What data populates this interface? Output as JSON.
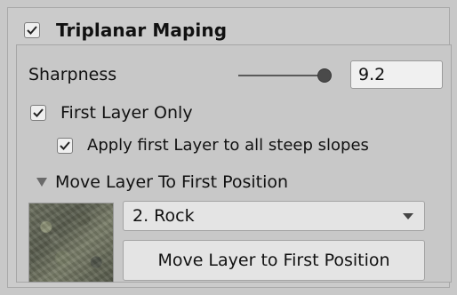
{
  "section": {
    "title": "Triplanar Maping",
    "enabled": true
  },
  "sharpness": {
    "label": "Sharpness",
    "value": "9.2",
    "slider_fraction": 0.92
  },
  "first_layer_only": {
    "label": "First Layer Only",
    "checked": true
  },
  "apply_steep": {
    "label": "Apply first Layer to all steep slopes",
    "checked": true
  },
  "move_foldout": {
    "label": "Move Layer To First Position",
    "expanded": true
  },
  "layer_select": {
    "value": "2. Rock"
  },
  "move_button": {
    "label": "Move Layer to First Position"
  },
  "icons": {
    "check": "check-icon",
    "foldout": "triangle-down-icon",
    "dropdown": "caret-down-icon"
  },
  "colors": {
    "background": "#c8c8c8",
    "field": "#f0f0f0",
    "button": "#e4e4e4"
  }
}
